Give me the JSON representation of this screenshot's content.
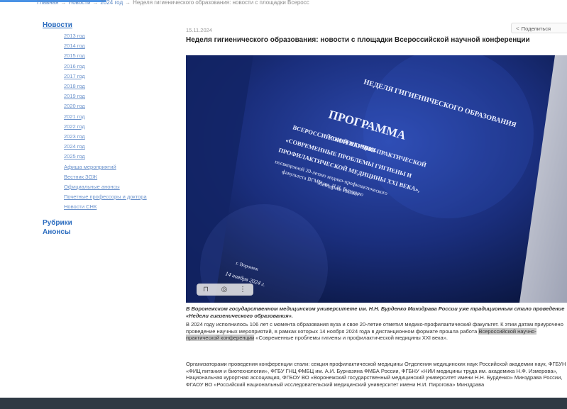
{
  "breadcrumb": [
    "Главная",
    "Новости",
    "2024 год",
    "Неделя гигиенического образования: новости с площадки Всеросс"
  ],
  "sidebar": {
    "heading": "Новости",
    "years": [
      "2013 год",
      "2014 год",
      "2015 год",
      "2016 год",
      "2017 год",
      "2018 год",
      "2019 год",
      "2020 год",
      "2021 год",
      "2022 год",
      "2023 год",
      "2024 год",
      "2025 год"
    ],
    "links": [
      "Афиша мероприятий",
      "Вестник ЗОЖ",
      "Официальные анонсы",
      "Почетные профессоры и доктора",
      "Новости СНК"
    ],
    "rubrics": "Рубрики",
    "announcements": "Анонсы"
  },
  "article": {
    "date": "15.11.2024",
    "share_label": "Поделиться",
    "title": "Неделя гигиенического образования: новости с площадки Всероссийской научной конференции",
    "photo": {
      "header": "НЕДЕЛЯ ГИГИЕНИЧЕСКОГО ОБРАЗОВАНИЯ",
      "program": "ПРОГРАММА",
      "lines": [
        "ВСЕРОССИЙСКОЙ НАУЧНО-ПРАКТИЧЕСКОЙ",
        "КОНФЕРЕНЦИИ",
        "«СОВРЕМЕННЫЕ ПРОБЛЕМЫ ГИГИЕНЫ И",
        "ПРОФИЛАКТИЧЕСКОЙ МЕДИЦИНЫ XXI ВЕКА»,",
        "посвященной 20-летию медико-профилактического",
        "факультета ВГМУ им. Н.Н. Бурденко",
        "Минздрава России"
      ],
      "city": "г. Воронеж",
      "date": "14 ноября 2024 г."
    },
    "caption": "В Воронежском государственном медицинском университете им. Н.Н. Бурденко Минздрава России уже традиционным стало проведение «Недели гигиенического образования».",
    "para1_a": "В 2024 году исполнилось 106 лет с момента образования вуза и свое 20-летие отметил медико-профилактический факультет. К этим датам приурочено проведение научных мероприятий, в рамках которых 14 ноября 2024 года в дистанционном формате прошла работа ",
    "para1_hl": "Всероссийской научно-практической конференции",
    "para1_b": " «Современные проблемы гигиены и профилактической медицины XXI века».",
    "para2": "Организаторами проведения конференции стали: секция профилактической медицины Отделения медицинских наук Российской академии наук, ФГБУН «ФИЦ питания и биотехнологии», ФГБУ ГНЦ ФМБЦ им. А.И. Бурназяна ФМБА России, ФГБНУ «НИИ медицины труда им. академика Н.Ф. Измерова», Национальная курортная ассоциация, ФГБОУ ВО «Воронежский государственный медицинский университет имени Н.Н. Бурденко» Минздрава России, ФГАОУ ВО «Российский национальный исследовательский медицинский университет имени Н.И. Пирогова» Минздрава"
  }
}
